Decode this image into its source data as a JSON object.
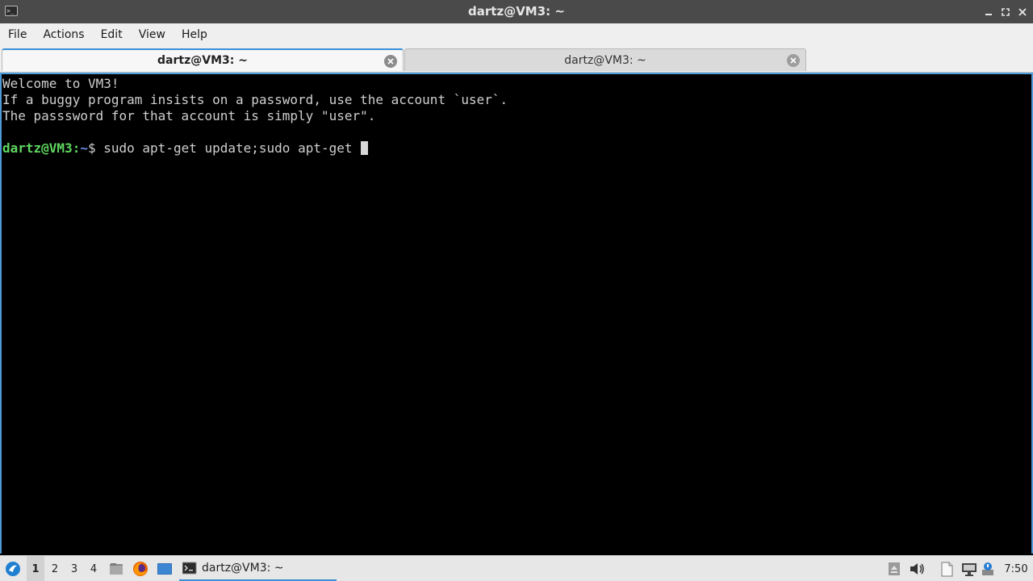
{
  "window": {
    "title": "dartz@VM3: ~"
  },
  "menu": {
    "items": [
      "File",
      "Actions",
      "Edit",
      "View",
      "Help"
    ]
  },
  "tabs": [
    {
      "label": "dartz@VM3: ~",
      "active": true
    },
    {
      "label": "dartz@VM3: ~",
      "active": false
    }
  ],
  "terminal": {
    "lines": [
      "Welcome to VM3!",
      "If a buggy program insists on a password, use the account `user`.",
      "The passsword for that account is simply \"user\".",
      ""
    ],
    "prompt": {
      "user_host": "dartz@VM3",
      "separator": ":",
      "path": "~",
      "symbol": "$ ",
      "command": "sudo apt-get update;sudo apt-get "
    }
  },
  "taskbar": {
    "workspaces": [
      "1",
      "2",
      "3",
      "4"
    ],
    "current_workspace": "1",
    "launchers": [
      "file-manager-icon",
      "firefox-icon",
      "show-desktop-icon"
    ],
    "task_label": "dartz@VM3: ~",
    "clock": "7:50"
  },
  "colors": {
    "prompt_user": "#5fd75f",
    "prompt_path": "#6b8ae6",
    "accent": "#3a8fd6",
    "titlebar": "#4a4a4a"
  }
}
